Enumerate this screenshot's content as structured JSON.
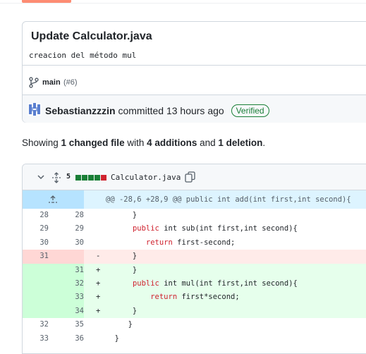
{
  "commit": {
    "title": "Update Calculator.java",
    "description": "creacion del método mul",
    "branch": "main",
    "pr": "(#6)",
    "author": "Sebastianzzzin",
    "committed_text": "committed 13 hours ago",
    "verified_label": "Verified"
  },
  "summary": {
    "prefix": "Showing ",
    "changed": "1 changed file",
    "with": " with ",
    "additions": "4 additions",
    "and": " and ",
    "deletions": "1 deletion",
    "suffix": "."
  },
  "diff": {
    "stat_count": "5",
    "stat_blocks": [
      "#1a7f37",
      "#1a7f37",
      "#1a7f37",
      "#1a7f37",
      "#cf222e"
    ],
    "filename": "Calculator.java",
    "hunk_header": "@@ -28,6 +28,9 @@ public int add(int first,int second){",
    "lines": [
      {
        "type": "ctx",
        "old": "28",
        "new": "28",
        "marker": "",
        "code": "      }"
      },
      {
        "type": "ctx",
        "old": "29",
        "new": "29",
        "marker": "",
        "code": "      public int sub(int first,int second){"
      },
      {
        "type": "ctx",
        "old": "30",
        "new": "30",
        "marker": "",
        "code": "         return first-second;"
      },
      {
        "type": "del",
        "old": "31",
        "new": "",
        "marker": "-",
        "code": "      }"
      },
      {
        "type": "add",
        "old": "",
        "new": "31",
        "marker": "+",
        "code": "      }"
      },
      {
        "type": "add",
        "old": "",
        "new": "32",
        "marker": "+",
        "code": "      public int mul(int first,int second){"
      },
      {
        "type": "add",
        "old": "",
        "new": "33",
        "marker": "+",
        "code": "          return first*second;"
      },
      {
        "type": "add",
        "old": "",
        "new": "34",
        "marker": "+",
        "code": "      }"
      },
      {
        "type": "ctx",
        "old": "32",
        "new": "35",
        "marker": "",
        "code": "     }"
      },
      {
        "type": "ctx",
        "old": "33",
        "new": "36",
        "marker": "",
        "code": "  }"
      }
    ]
  },
  "colors": {
    "addition": "#1a7f37",
    "deletion": "#cf222e",
    "hunk": "#ddf4ff",
    "accent_tab": "#fd8c73"
  },
  "icons": [
    "git-branch-icon",
    "avatar",
    "chevron-down-icon",
    "unfold-icon",
    "copy-icon",
    "expand-up-icon"
  ]
}
